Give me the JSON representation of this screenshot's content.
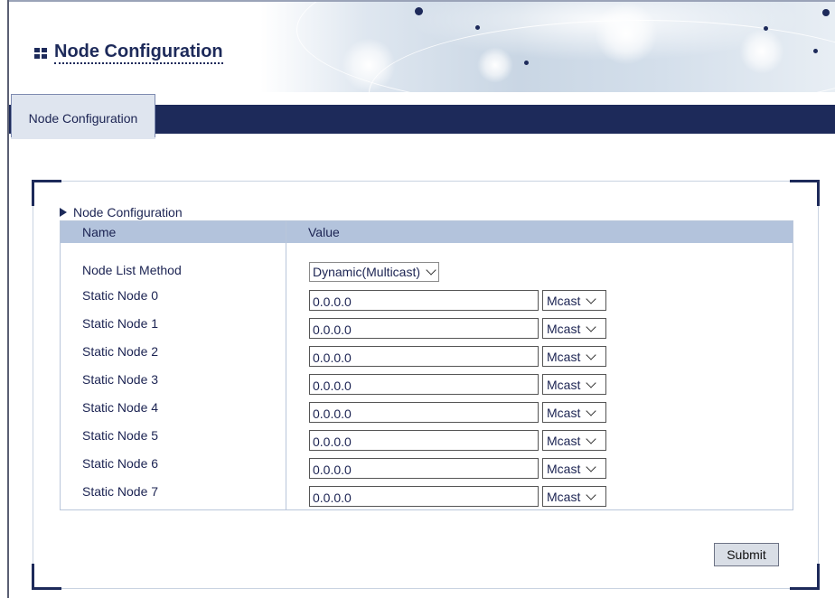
{
  "header": {
    "title": "Node Configuration"
  },
  "tabs": [
    {
      "label": "Node Configuration"
    }
  ],
  "section": {
    "title": "Node Configuration"
  },
  "table": {
    "col_name": "Name",
    "col_value": "Value",
    "method": {
      "label": "Node List Method",
      "value": "Dynamic(Multicast)"
    },
    "nodes": [
      {
        "label": "Static Node 0",
        "ip": "0.0.0.0",
        "mode": "Mcast"
      },
      {
        "label": "Static Node 1",
        "ip": "0.0.0.0",
        "mode": "Mcast"
      },
      {
        "label": "Static Node 2",
        "ip": "0.0.0.0",
        "mode": "Mcast"
      },
      {
        "label": "Static Node 3",
        "ip": "0.0.0.0",
        "mode": "Mcast"
      },
      {
        "label": "Static Node 4",
        "ip": "0.0.0.0",
        "mode": "Mcast"
      },
      {
        "label": "Static Node 5",
        "ip": "0.0.0.0",
        "mode": "Mcast"
      },
      {
        "label": "Static Node 6",
        "ip": "0.0.0.0",
        "mode": "Mcast"
      },
      {
        "label": "Static Node 7",
        "ip": "0.0.0.0",
        "mode": "Mcast"
      }
    ]
  },
  "actions": {
    "submit": "Submit"
  },
  "colors": {
    "navy": "#1d2a5a",
    "table_header": "#b3c3dc",
    "tab_bg": "#dfe5ef"
  }
}
